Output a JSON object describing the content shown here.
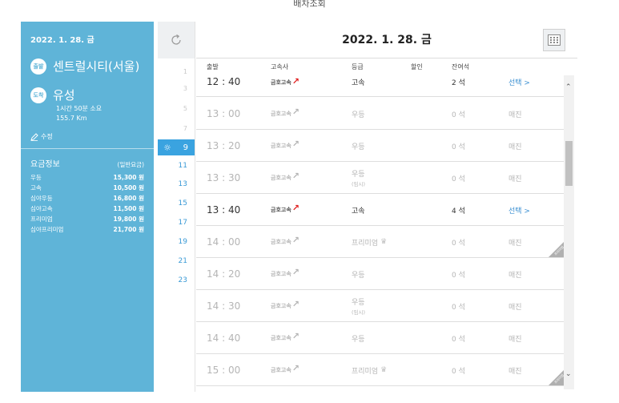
{
  "page": {
    "top_title": "배차조회"
  },
  "left": {
    "date": "2022. 1. 28. 금",
    "departure_badge": "출발",
    "departure": "센트럴시티(서울)",
    "arrival_badge": "도착",
    "arrival": "유성",
    "duration": "1시간 50분 소요",
    "distance": "155.7 Km",
    "edit": "수정",
    "fare_title": "요금정보",
    "fare_subtitle": "(일반요금)",
    "fares": [
      {
        "grade": "우등",
        "price": "15,300 원"
      },
      {
        "grade": "고속",
        "price": "10,500 원"
      },
      {
        "grade": "심야우등",
        "price": "16,800 원"
      },
      {
        "grade": "심야고속",
        "price": "11,500 원"
      },
      {
        "grade": "프리미엄",
        "price": "19,800 원"
      },
      {
        "grade": "심야프리미엄",
        "price": "21,700 원"
      }
    ]
  },
  "hours": {
    "selected": "9",
    "list": [
      "1",
      "3",
      "5",
      "7",
      "11",
      "13",
      "15",
      "17",
      "19",
      "21",
      "23"
    ]
  },
  "main": {
    "title": "2022. 1. 28. 금",
    "columns": {
      "dep": "출발",
      "company": "고속사",
      "grade": "등급",
      "discount": "할인",
      "seats": "잔여석"
    },
    "rows": [
      {
        "time": "12 : 40",
        "company": "금호고속",
        "grade": "고속",
        "grade_sub": "",
        "seats": "2 석",
        "action": "선택 >",
        "active": true,
        "premium": false
      },
      {
        "time": "13 : 00",
        "company": "금호고속",
        "grade": "우등",
        "grade_sub": "",
        "seats": "0 석",
        "action": "매진",
        "active": false,
        "premium": false
      },
      {
        "time": "13 : 20",
        "company": "금호고속",
        "grade": "우등",
        "grade_sub": "",
        "seats": "0 석",
        "action": "매진",
        "active": false,
        "premium": false
      },
      {
        "time": "13 : 30",
        "company": "금호고속",
        "grade": "우등",
        "grade_sub": "(임시)",
        "seats": "0 석",
        "action": "매진",
        "active": false,
        "premium": false
      },
      {
        "time": "13 : 40",
        "company": "금호고속",
        "grade": "고속",
        "grade_sub": "",
        "seats": "4 석",
        "action": "선택 >",
        "active": true,
        "premium": false
      },
      {
        "time": "14 : 00",
        "company": "금호고속",
        "grade": "프리미엄",
        "grade_sub": "",
        "seats": "0 석",
        "action": "매진",
        "active": false,
        "premium": true
      },
      {
        "time": "14 : 20",
        "company": "금호고속",
        "grade": "우등",
        "grade_sub": "",
        "seats": "0 석",
        "action": "매진",
        "active": false,
        "premium": false
      },
      {
        "time": "14 : 30",
        "company": "금호고속",
        "grade": "우등",
        "grade_sub": "(임시)",
        "seats": "0 석",
        "action": "매진",
        "active": false,
        "premium": false
      },
      {
        "time": "14 : 40",
        "company": "금호고속",
        "grade": "우등",
        "grade_sub": "",
        "seats": "0 석",
        "action": "매진",
        "active": false,
        "premium": false
      },
      {
        "time": "15 : 00",
        "company": "금호고속",
        "grade": "프리미엄",
        "grade_sub": "",
        "seats": "0 석",
        "action": "매진",
        "active": false,
        "premium": true
      }
    ],
    "premium_tag": "프리미엄"
  },
  "bottom": {
    "text_a": "",
    "text_b": ""
  },
  "colors": {
    "panel": "#5fb4d8",
    "selected_hour": "#3aa3e0",
    "link": "#3a8fd1",
    "arrow_red": "#e02020"
  },
  "icons": {
    "refresh": "refresh-icon",
    "calendar": "calendar-icon",
    "edit": "pencil-icon",
    "sun": "sun-icon",
    "crown": "crown-icon"
  }
}
